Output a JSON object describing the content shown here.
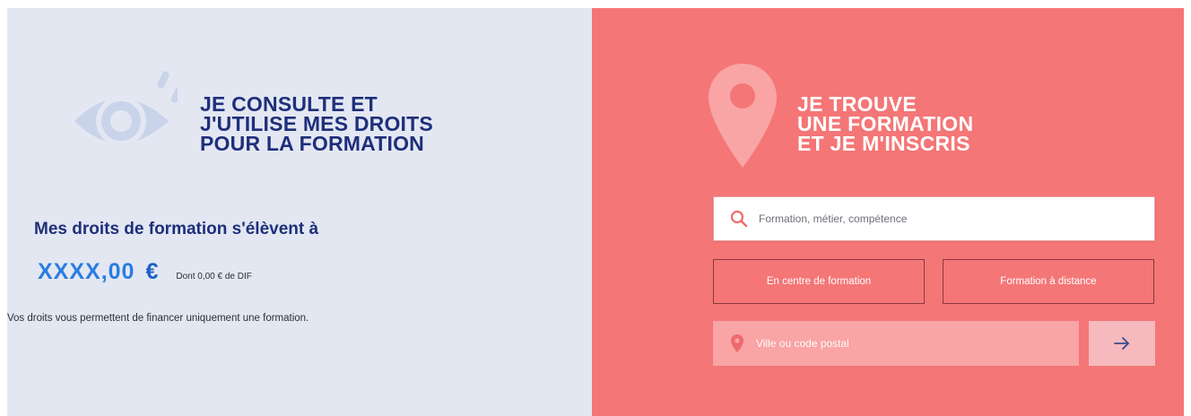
{
  "left_panel": {
    "title_lines": [
      "JE CONSULTE ET",
      "J'UTILISE MES DROITS",
      "POUR LA FORMATION"
    ],
    "eye_icon": "eye-icon",
    "rights_heading": "Mes droits de formation s'élèvent à",
    "amount": "XXXX,00",
    "currency": "€",
    "dif_text": "Dont 0,00 € de DIF",
    "note": "Vos droits vous permettent de financer uniquement une formation."
  },
  "right_panel": {
    "title_lines": [
      "JE TROUVE",
      "UNE FORMATION",
      "ET JE M'INSCRIS"
    ],
    "pin_icon": "location-pin-icon",
    "search": {
      "placeholder": "Formation, métier, compétence",
      "icon": "search-icon"
    },
    "modes": [
      {
        "label": "En centre de formation"
      },
      {
        "label": "Formation à distance"
      }
    ],
    "city": {
      "placeholder": "Ville ou code postal",
      "icon": "location-pin-icon"
    },
    "submit_icon": "arrow-right-icon"
  },
  "colors": {
    "left_bg": "#e3e7f2",
    "right_bg": "#f47677",
    "navy": "#1f2f7a",
    "accent_blue": "#2a7de1",
    "white": "#ffffff"
  }
}
